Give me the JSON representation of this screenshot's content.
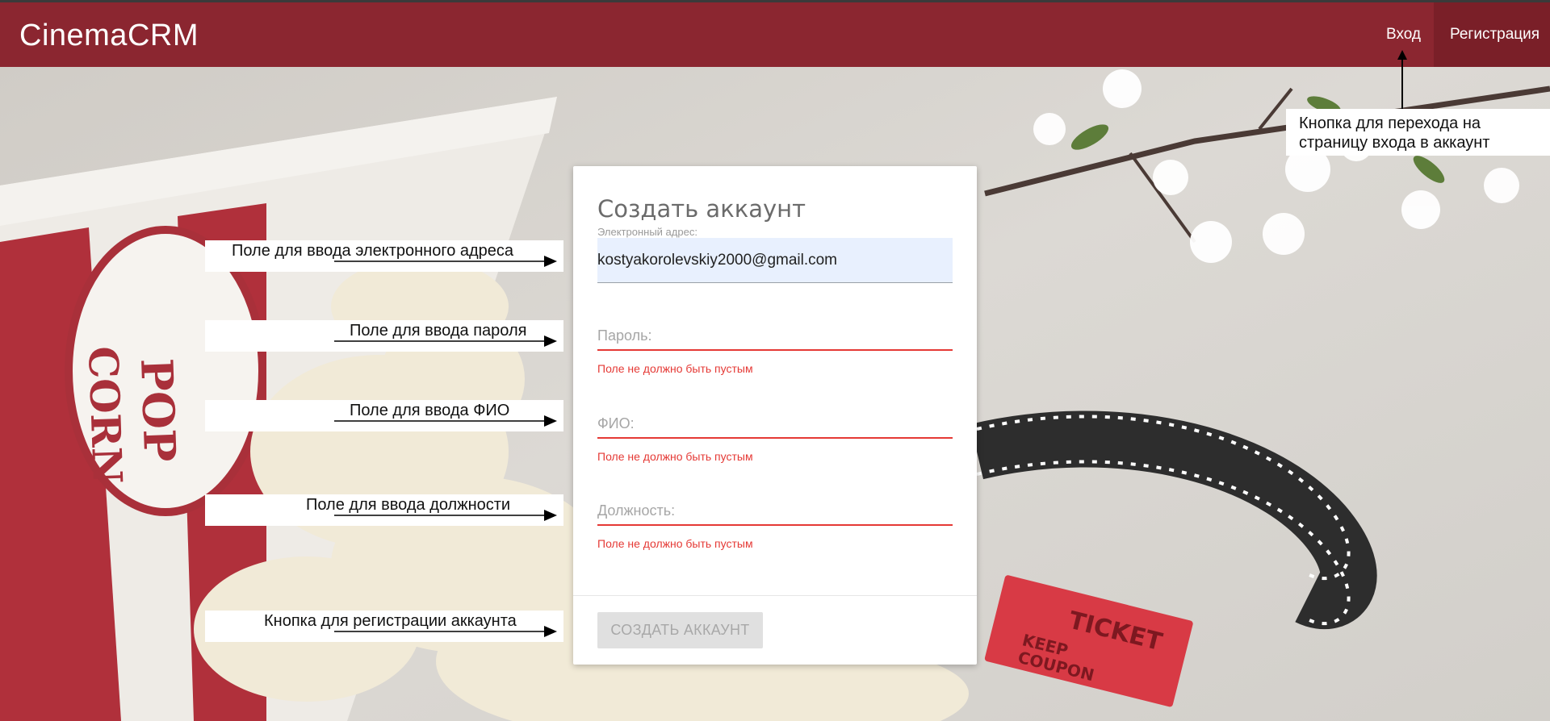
{
  "nav": {
    "brand": "CinemaCRM",
    "login": "Вход",
    "register": "Регистрация"
  },
  "annotations": {
    "email": "Поле для ввода электронного адреса",
    "password": "Поле для ввода пароля",
    "fio": "Поле для ввода ФИО",
    "position": "Поле для ввода должности",
    "register_button": "Кнопка для регистрации аккаунта",
    "login_link": "Кнопка для перехода на страницу входа в аккаунт"
  },
  "form": {
    "title": "Создать аккаунт",
    "email_label": "Электронный адрес:",
    "email_value": "kostyakorolevskiy2000@gmail.com",
    "password_placeholder": "Пароль:",
    "fio_placeholder": "ФИО:",
    "position_placeholder": "Должность:",
    "error_text": "Поле не должно быть пустым",
    "submit_label": "Создать аккаунт"
  },
  "colors": {
    "nav_bg": "#8b2630",
    "error": "#e53935",
    "email_fill": "#e8f0fe"
  },
  "background_items": [
    "popcorn-box",
    "popcorn",
    "cherry-blossom-branch",
    "film-strip",
    "ticket"
  ]
}
